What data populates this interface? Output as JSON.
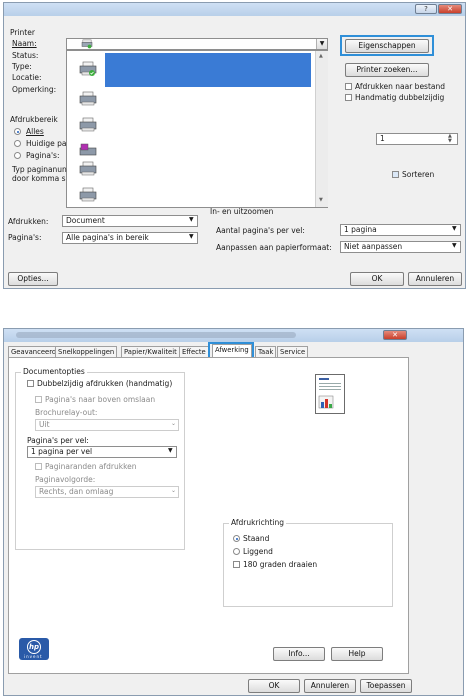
{
  "dialog1": {
    "printer_section": "Printer",
    "name_label": "Naam:",
    "status_label": "Status:",
    "type_label": "Type:",
    "location_label": "Locatie:",
    "comment_label": "Opmerking:",
    "properties_button": "Eigenschappen",
    "find_printer_button": "Printer zoeken...",
    "print_to_file_label": "Afdrukken naar bestand",
    "manual_duplex_label": "Handmatig dubbelzijdig",
    "print_range_label": "Afdrukbereik",
    "range_all": "Alles",
    "range_current": "Huidige pa",
    "range_pages": "Pagina's:",
    "range_hint_1": "Typ paginanun",
    "range_hint_2": "door komma s",
    "copies_value": "1",
    "collate_label": "Sorteren",
    "zoom_label": "In- en uitzoomen",
    "print_what_label": "Afdrukken:",
    "print_what_value": "Document",
    "pages_label": "Pagina's:",
    "pages_value": "Alle pagina's in bereik",
    "pages_per_sheet_label": "Aantal pagina's per vel:",
    "pages_per_sheet_value": "1 pagina",
    "scale_label": "Aanpassen aan papierformaat:",
    "scale_value": "Niet aanpassen",
    "options_button": "Opties...",
    "ok_button": "OK",
    "cancel_button": "Annuleren",
    "help_glyph": "?"
  },
  "dialog2": {
    "tabs": [
      "Geavanceerd",
      "Snelkoppelingen",
      "Papier/Kwaliteit",
      "Effecte",
      "Afwerking",
      "Taak",
      "Service"
    ],
    "active_tab": "Afwerking",
    "document_options": "Documentopties",
    "duplex_label": "Dubbelzijdig afdrukken (handmatig)",
    "flip_up_label": "Pagina's naar boven omslaan",
    "booklet_label": "Brochurelay-out:",
    "booklet_value": "Uit",
    "pps_label": "Pagina's per vel:",
    "pps_value": "1 pagina per vel",
    "borders_label": "Paginaranden afdrukken",
    "order_label": "Paginavolgorde:",
    "order_value": "Rechts, dan omlaag",
    "orientation_label": "Afdrukrichting",
    "portrait_label": "Staand",
    "landscape_label": "Liggend",
    "rotate_label": "180 graden draaien",
    "info_button": "Info...",
    "help_button": "Help",
    "ok_button": "OK",
    "cancel_button": "Annuleren",
    "apply_button": "Toepassen",
    "logo_text": "hp",
    "logo_sub": "invent"
  },
  "colors": {
    "highlight": "#2f8fd8",
    "selection": "#3a7bd5",
    "titlebar": "#c4d7ee"
  }
}
